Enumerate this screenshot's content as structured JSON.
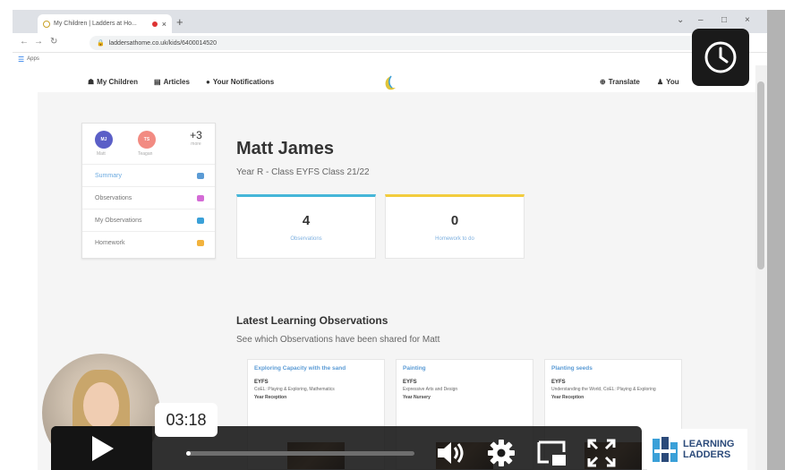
{
  "browser": {
    "tab_title": "My Children | Ladders at Ho...",
    "close_tab": "×",
    "new_tab": "+",
    "url": "laddersathome.co.uk/kids/6400014520",
    "bookmarks_label": "Apps",
    "win_controls": [
      "⌄",
      "–",
      "□",
      "×"
    ]
  },
  "nav": {
    "my_children": "My Children",
    "articles": "Articles",
    "notifications": "Your Notifications",
    "translate": "Translate",
    "you": "You"
  },
  "child_card": {
    "avatars": [
      {
        "initials": "MJ",
        "name": "Matt",
        "color": "#5b5fc7"
      },
      {
        "initials": "TS",
        "name": "Teagan",
        "color": "#f28b82"
      }
    ],
    "more_count": "+3",
    "more_label": "more",
    "menu": [
      {
        "label": "Summary",
        "active": true,
        "color": "#5b9bd5"
      },
      {
        "label": "Observations",
        "active": false,
        "color": "#d46bd6"
      },
      {
        "label": "My Observations",
        "active": false,
        "color": "#3aa0d8"
      },
      {
        "label": "Homework",
        "active": false,
        "color": "#f2b33d"
      }
    ]
  },
  "child": {
    "name": "Matt James",
    "class_info": "Year R - Class EYFS Class 21/22"
  },
  "stats": [
    {
      "value": "4",
      "label": "Observations",
      "accent": "#45b6d8"
    },
    {
      "value": "0",
      "label": "Homework to do",
      "accent": "#f2cc3d"
    }
  ],
  "latest": {
    "title": "Latest Learning Observations",
    "subtitle": "See which Observations have been shared for Matt",
    "cards": [
      {
        "title": "Exploring Capacity with the sand",
        "heading": "EYFS",
        "subjects": "CoEL: Playing & Exploring, Mathematics",
        "year": "Year Reception"
      },
      {
        "title": "Painting",
        "heading": "EYFS",
        "subjects": "Expressive Arts and Design",
        "year": "Year Nursery"
      },
      {
        "title": "Planting seeds",
        "heading": "EYFS",
        "subjects": "Understanding the World, CoEL: Playing & Exploring",
        "year": "Year Reception"
      }
    ]
  },
  "video": {
    "timestamp": "03:18",
    "progress_fraction": 0.02
  },
  "brand": {
    "line1": "LEARNING",
    "line2": "LADDERS"
  }
}
